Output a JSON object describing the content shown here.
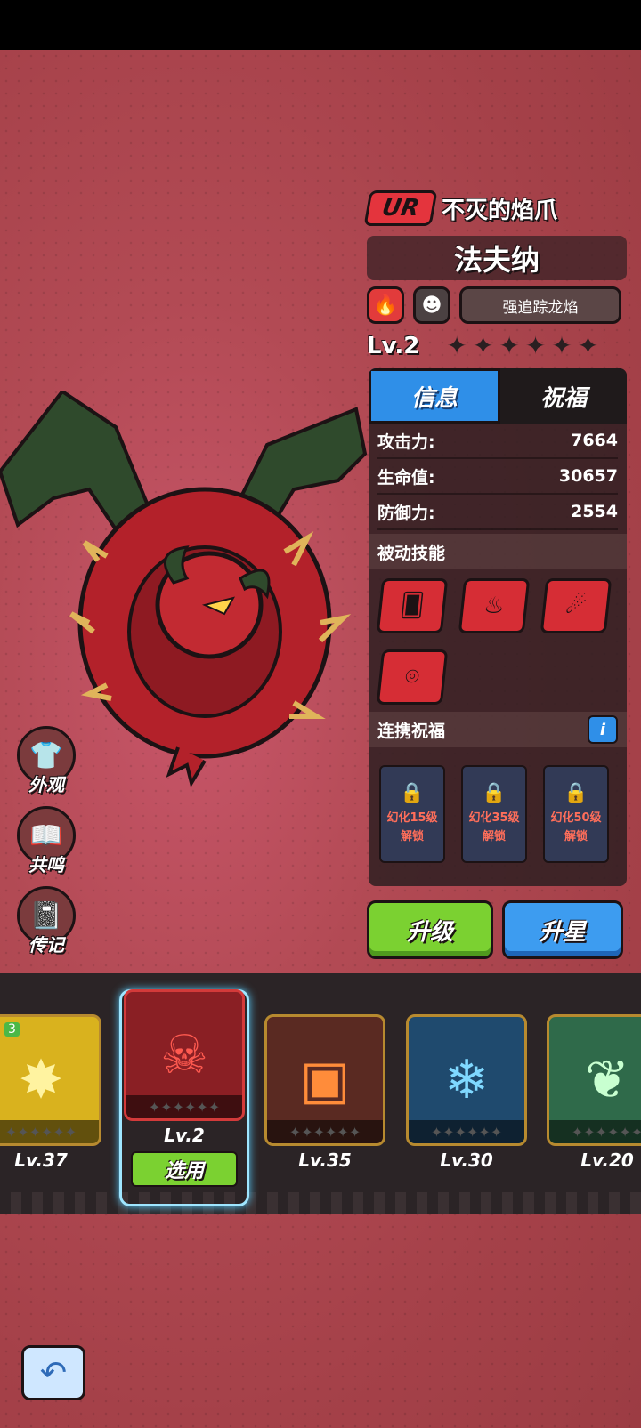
{
  "hero": {
    "rarity": "UR",
    "epithet": "不灭的焰爪",
    "name": "法夫纳",
    "skill_tag": "强追踪龙焰",
    "level": "Lv.2",
    "stars_total": 6,
    "stars_filled": 0
  },
  "tabs": [
    {
      "label": "信息",
      "active": true
    },
    {
      "label": "祝福",
      "active": false
    }
  ],
  "stats": [
    {
      "label": "攻击力:",
      "value": "7664"
    },
    {
      "label": "生命值:",
      "value": "30657"
    },
    {
      "label": "防御力:",
      "value": "2554"
    }
  ],
  "sections": {
    "passive": "被动技能",
    "linked": "连携祝福",
    "info_icon": "i"
  },
  "locks": [
    {
      "line1": "幻化15级",
      "line2": "解锁"
    },
    {
      "line1": "幻化35级",
      "line2": "解锁"
    },
    {
      "line1": "幻化50级",
      "line2": "解锁"
    }
  ],
  "buttons": {
    "upgrade": "升级",
    "star_up": "升星",
    "select": "选用"
  },
  "side": [
    {
      "label": "外观",
      "icon": "shirt-icon"
    },
    {
      "label": "共鸣",
      "icon": "book-icon"
    },
    {
      "label": "传记",
      "icon": "journal-icon"
    }
  ],
  "roster": [
    {
      "level": "Lv.37",
      "badge": "3"
    },
    {
      "level": "Lv.2"
    },
    {
      "level": "Lv.35"
    },
    {
      "level": "Lv.30"
    },
    {
      "level": "Lv.20"
    }
  ],
  "colors": {
    "accent_red": "#e4343d",
    "tab_blue": "#2f8fe8",
    "button_green": "#7bd131",
    "button_blue": "#3d9cf0",
    "lock_text": "#ff6e5a"
  }
}
